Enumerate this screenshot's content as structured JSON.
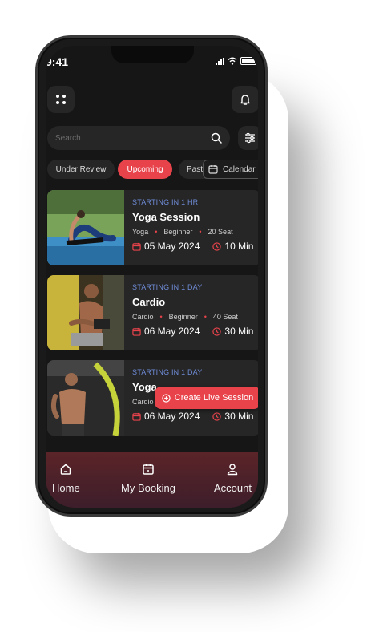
{
  "status_bar": {
    "time": "9:41"
  },
  "search": {
    "placeholder": "Search"
  },
  "filters": {
    "chips": [
      "Under Review",
      "Upcoming",
      "Past"
    ],
    "selected": "Upcoming",
    "calendar_label": "Calendar"
  },
  "sessions": [
    {
      "starting": "STARTING IN 1 HR",
      "title": "Yoga Session",
      "category": "Yoga",
      "level": "Beginner",
      "seats": "20 Seat",
      "date": "05 May 2024",
      "duration": "10 Min"
    },
    {
      "starting": "STARTING IN 1 DAY",
      "title": "Cardio",
      "category": "Cardio",
      "level": "Beginner",
      "seats": "40 Seat",
      "date": "06 May 2024",
      "duration": "30 Min"
    },
    {
      "starting": "STARTING IN 1 DAY",
      "title": "Yoga",
      "category": "Cardio",
      "date": "06 May 2024",
      "duration": "30 Min"
    }
  ],
  "fab": {
    "label": "Create Live Session"
  },
  "bottom_nav": {
    "home": "Home",
    "booking": "My Booking",
    "account": "Account"
  },
  "colors": {
    "accent": "#e8434b",
    "starting_text": "#6f8cd8",
    "card_bg": "#262626",
    "screen_bg": "#161616"
  }
}
